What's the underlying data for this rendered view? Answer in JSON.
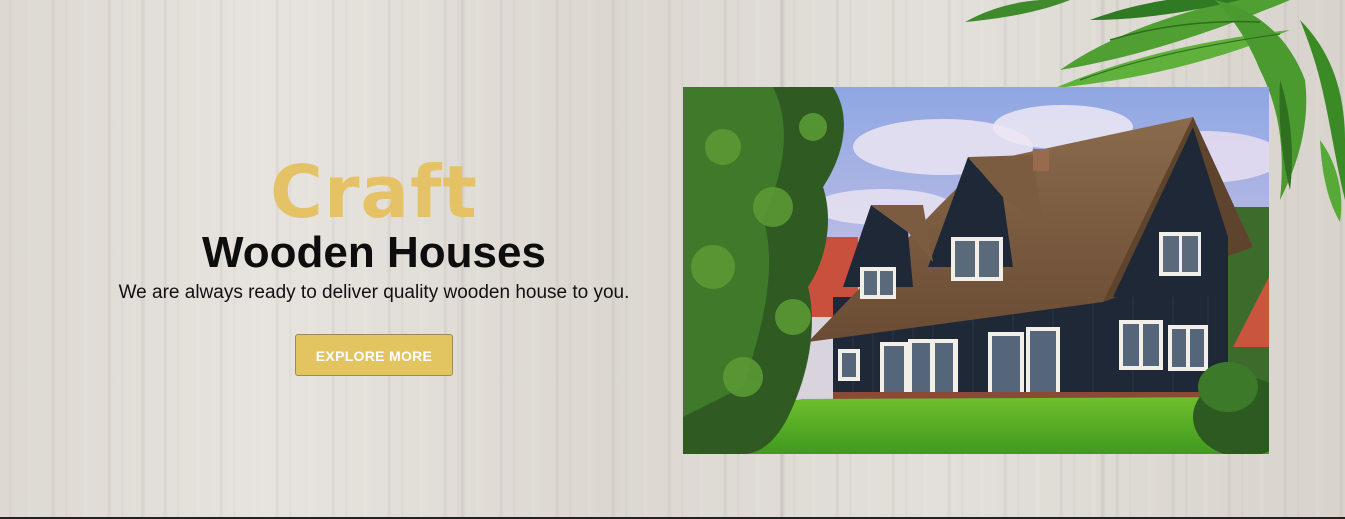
{
  "hero": {
    "accent": "Craft",
    "title": "Wooden Houses",
    "subtitle": "We are always ready to deliver quality wooden house to you.",
    "cta_label": "EXPLORE MORE"
  },
  "colors": {
    "accent": "#e4c265",
    "button": "#e2c461",
    "title": "#0d0d0d"
  },
  "icons": {
    "decoration": "leaves-icon",
    "photo": "wooden-house-photo"
  }
}
